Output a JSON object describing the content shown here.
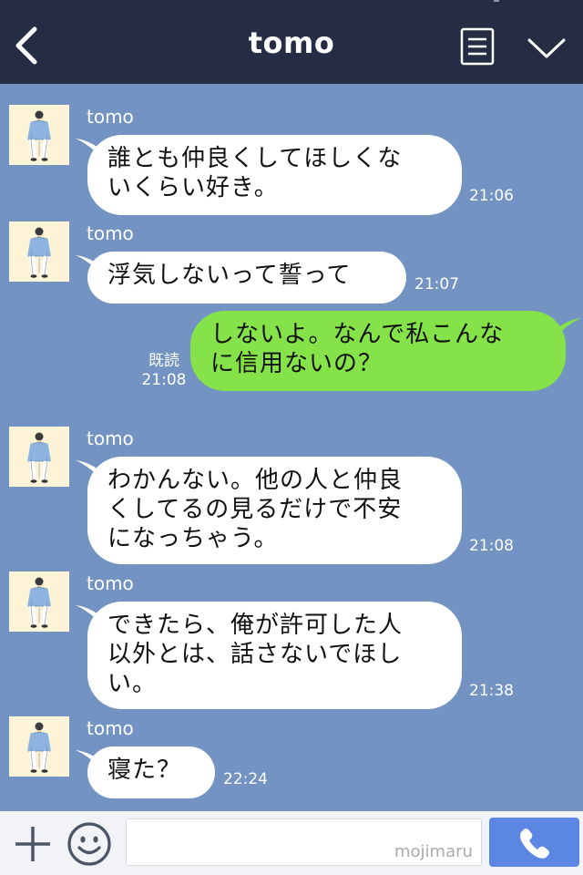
{
  "header": {
    "title": "tomo",
    "back_icon": "chevron-left-icon",
    "menu_icon": "list-menu-icon",
    "collapse_icon": "chevron-down-icon"
  },
  "messages": [
    {
      "direction": "in",
      "sender": "tomo",
      "lines": [
        "誰とも仲良くしてほしくな",
        "いくらい好き。"
      ],
      "time": "21:06"
    },
    {
      "direction": "in",
      "sender": "tomo",
      "lines": [
        "浮気しないって誓って"
      ],
      "time": "21:07"
    },
    {
      "direction": "out",
      "lines": [
        "しないよ。なんで私こんな",
        "に信用ないの？"
      ],
      "read": "既読",
      "time": "21:08"
    },
    {
      "direction": "in",
      "sender": "tomo",
      "lines": [
        "わかんない。他の人と仲良",
        "くしてるの見るだけで不安",
        "になっちゃう。"
      ],
      "time": "21:08"
    },
    {
      "direction": "in",
      "sender": "tomo",
      "lines": [
        "できたら、俺が許可した人",
        "以外とは、話さないでほし",
        "い。"
      ],
      "time": "21:38"
    },
    {
      "direction": "in",
      "sender": "tomo",
      "lines": [
        "寝た？"
      ],
      "time": "22:24"
    }
  ],
  "input_bar": {
    "add_icon": "plus-icon",
    "emoji_icon": "smiley-icon",
    "message_value": "",
    "watermark": "mojimaru",
    "call_icon": "phone-icon"
  },
  "colors": {
    "header_bg": "#242d43",
    "chat_bg": "#7393c3",
    "incoming_bubble": "#ffffff",
    "outgoing_bubble": "#85e249",
    "call_button": "#5b86e2"
  }
}
